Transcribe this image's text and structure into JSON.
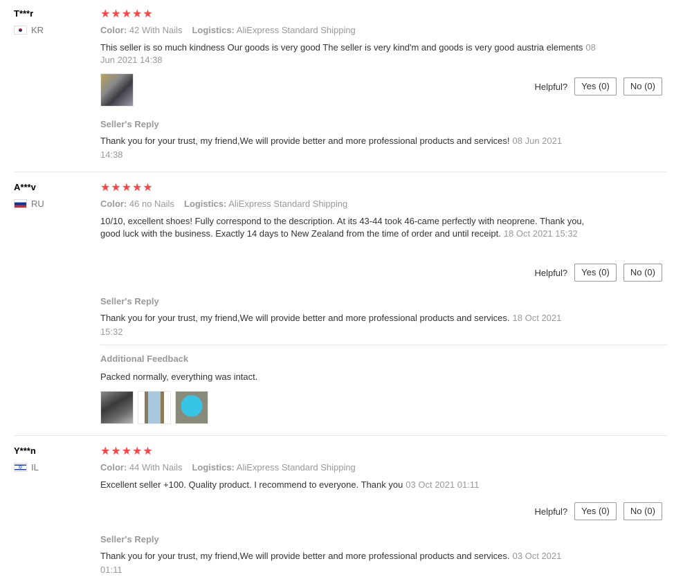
{
  "labels": {
    "color": "Color:",
    "logistics": "Logistics:",
    "helpful": "Helpful?",
    "seller_reply": "Seller's Reply",
    "additional_feedback": "Additional Feedback"
  },
  "reviews": [
    {
      "user": "T***r",
      "country": "KR",
      "stars": "★★★★★",
      "rating": 5,
      "color_value": "42 With Nails",
      "logistics_value": "AliExpress Standard Shipping",
      "text": "This seller is so much kindness Our goods is very good The seller is very kind'm and goods is very good austria elements",
      "date": "08 Jun 2021 14:38",
      "yes": "Yes (0)",
      "no": "No (0)",
      "reply_text": "Thank you for your trust, my friend,We will provide better and more professional products and services!",
      "reply_date": "08 Jun 2021 14:38"
    },
    {
      "user": "A***v",
      "country": "RU",
      "stars": "★★★★★",
      "rating": 5,
      "color_value": "46 no Nails",
      "logistics_value": "AliExpress Standard Shipping",
      "text": "10/10, excellent shoes! Fully correspond to the description. At its 43-44 took 46-came perfectly with neoprene. Thank you, good luck with the business. Exactly 14 days to New Zealand from the time of order and until receipt.",
      "date": "18 Oct 2021 15:32",
      "yes": "Yes (0)",
      "no": "No (0)",
      "reply_text": "Thank you for your trust, my friend,We will provide better and more professional products and services.",
      "reply_date": "18 Oct 2021 15:32",
      "additional_text": "Packed normally, everything was intact."
    },
    {
      "user": "Y***n",
      "country": "IL",
      "stars": "★★★★★",
      "rating": 5,
      "color_value": "44 With Nails",
      "logistics_value": "AliExpress Standard Shipping",
      "text": "Excellent seller +100. Quality product. I recommend to everyone. Thank you",
      "date": "03 Oct 2021 01:11",
      "yes": "Yes (0)",
      "no": "No (0)",
      "reply_text": "Thank you for your trust, my friend,We will provide better and more professional products and services.",
      "reply_date": "03 Oct 2021 01:11"
    }
  ]
}
